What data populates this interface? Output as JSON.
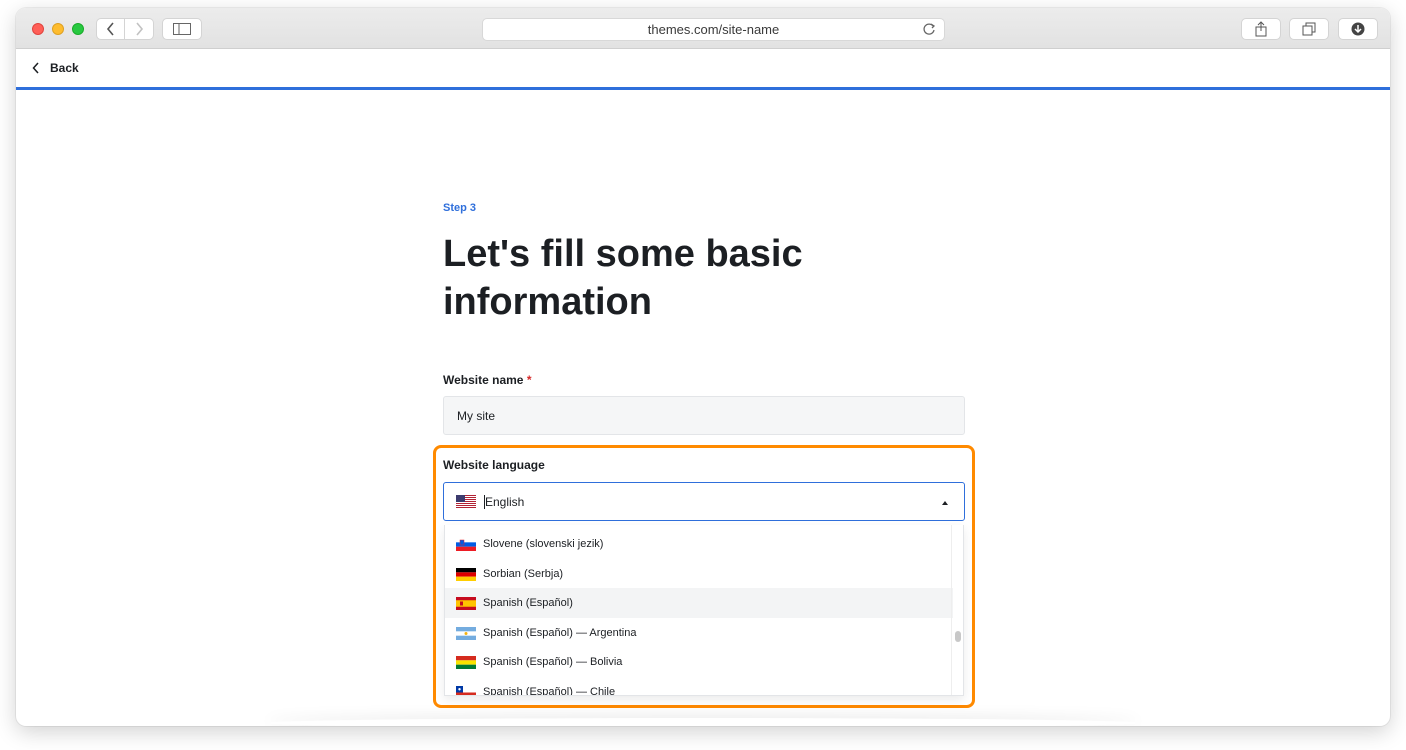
{
  "browser": {
    "url": "themes.com/site-name",
    "icons": [
      "chevron-left-icon",
      "chevron-right-icon",
      "sidebar-icon",
      "reload-icon",
      "share-icon",
      "tabs-icon",
      "download-icon"
    ]
  },
  "back": {
    "label": "Back"
  },
  "form": {
    "step": "Step 3",
    "title": "Let's fill some basic information",
    "name_label": "Website name",
    "required_mark": "*",
    "name_value": "My site",
    "language_label": "Website language",
    "language_value": "English",
    "language_options": [
      {
        "label": "Slovene (slovenski jezik)",
        "flag": "si"
      },
      {
        "label": "Sorbian (Serbja)",
        "flag": "de"
      },
      {
        "label": "Spanish (Español)",
        "flag": "es",
        "hover": true
      },
      {
        "label": "Spanish (Español) — Argentina",
        "flag": "ar"
      },
      {
        "label": "Spanish (Español) — Bolivia",
        "flag": "bo"
      },
      {
        "label": "Spanish (Español) — Chile",
        "flag": "cl"
      }
    ]
  },
  "colors": {
    "accent": "#2f6fdb",
    "highlight": "#ff8a00",
    "required": "#d62828"
  }
}
